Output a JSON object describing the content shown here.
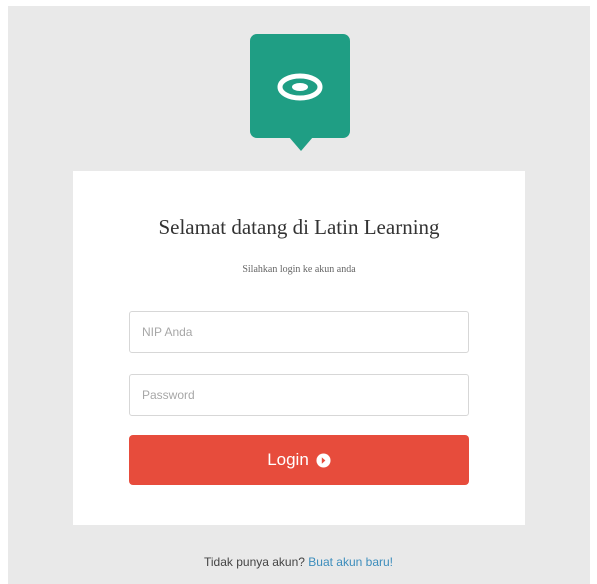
{
  "colors": {
    "page_background": "#e9e9e9",
    "brand_green": "#1f9e84",
    "login_button": "#e74c3c",
    "link": "#3c8dbc"
  },
  "logo": {
    "icon": "eye-ring-logo-icon"
  },
  "login_card": {
    "title": "Selamat datang di Latin Learning",
    "subtitle": "Silahkan login ke akun anda",
    "nip_field": {
      "value": "",
      "placeholder": "NIP Anda"
    },
    "password_field": {
      "value": "",
      "placeholder": "Password"
    },
    "login_button": {
      "label": "Login",
      "icon": "arrow-circle-right-icon"
    }
  },
  "signup": {
    "prompt": "Tidak punya akun?",
    "link_label": "Buat akun baru!"
  }
}
